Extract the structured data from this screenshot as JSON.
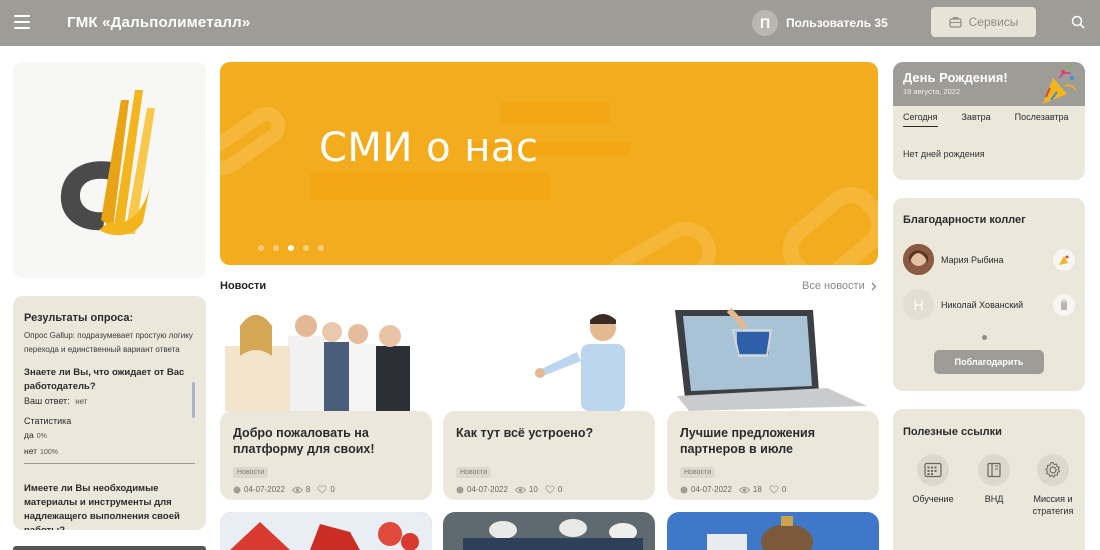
{
  "header": {
    "brand": "ГМК «Дальполиметалл»",
    "user_initial": "П",
    "user_name": "Пользователь 35",
    "services_label": "Сервисы"
  },
  "banner": {
    "title": "СМИ о нас",
    "slides_count": 5,
    "active_slide": 3
  },
  "survey": {
    "title": "Результаты опроса:",
    "description": "Опрос Gallup: подразумевает простую логику перехода и единственный вариант ответа",
    "question1": "Знаете ли Вы, что ожидает от Вас работодатель?",
    "your_answer_label": "Ваш ответ:",
    "your_answer": "нет",
    "stats_label": "Статистика",
    "stats": [
      {
        "label": "да",
        "percent": "0%"
      },
      {
        "label": "нет",
        "percent": "100%"
      }
    ],
    "question2": "Имеете ли Вы необходимые материалы и инструменты для надлежащего выполнения своей работы?"
  },
  "news": {
    "heading": "Новости",
    "all_label": "Все новости",
    "items": [
      {
        "title": "Добро пожаловать на платформу для своих!",
        "tag": "Новости",
        "date": "04-07-2022",
        "views": "8",
        "likes": "0"
      },
      {
        "title": "Как тут всё устроено?",
        "tag": "Новости",
        "date": "04-07-2022",
        "views": "10",
        "likes": "0"
      },
      {
        "title": "Лучшие предложения партнеров в июле",
        "tag": "Новости",
        "date": "04-07-2022",
        "views": "18",
        "likes": "0"
      }
    ]
  },
  "birthday": {
    "title": "День Рождения!",
    "date": "19 августа, 2022",
    "tabs": [
      "Сегодня",
      "Завтра",
      "Послезавтра"
    ],
    "empty": "Нет дней рождения"
  },
  "thanks": {
    "title": "Благодарности коллег",
    "people": [
      {
        "name": "Мария Рыбина",
        "initial": ""
      },
      {
        "name": "Николай Хованский",
        "initial": "Н"
      }
    ],
    "button": "Поблагодарить"
  },
  "links": {
    "title": "Полезные ссылки",
    "items": [
      {
        "label": "Обучение",
        "icon": "calendar-grid-icon"
      },
      {
        "label": "ВНД",
        "icon": "document-book-icon"
      },
      {
        "label": "Миссия и стратегия",
        "icon": "gear-icon"
      }
    ]
  },
  "colors": {
    "header": "#9e9c97",
    "card": "#ebe7db",
    "banner": "#f4ac1f",
    "logo_dark": "#4a4a4a",
    "logo_gold": "#f2b51e"
  }
}
